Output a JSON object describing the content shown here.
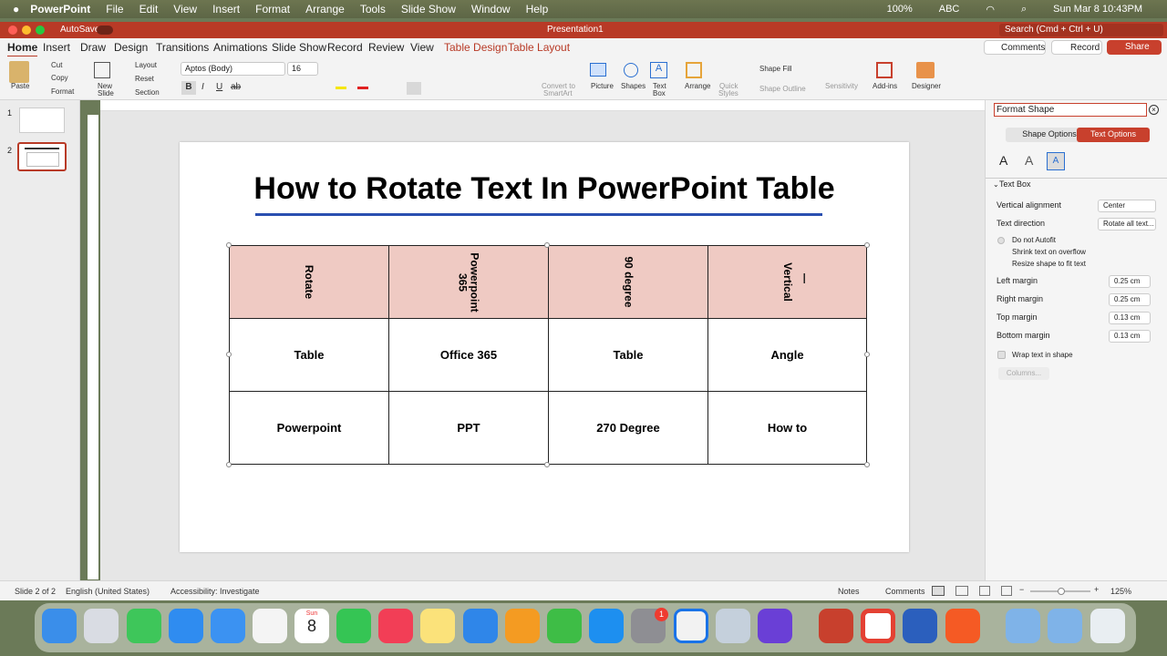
{
  "menubar": {
    "app_name": "PowerPoint",
    "items": [
      "File",
      "Edit",
      "View",
      "Insert",
      "Format",
      "Arrange",
      "Tools",
      "Slide Show",
      "Window",
      "Help"
    ],
    "battery": "100%",
    "keyboard": "ABC",
    "datetime": "Sun Mar 8  10:43PM"
  },
  "titlebar": {
    "autosave": "AutoSave",
    "document_title": "Presentation1",
    "search_placeholder": "Search (Cmd + Ctrl + U)"
  },
  "tabs": [
    "Home",
    "Insert",
    "Draw",
    "Design",
    "Transitions",
    "Animations",
    "Slide Show",
    "Record",
    "Review",
    "View",
    "Table Design",
    "Table Layout"
  ],
  "actions": {
    "comments": "Comments",
    "record": "Record",
    "share": "Share"
  },
  "ribbon": {
    "paste": "Paste",
    "cut": "Cut",
    "copy": "Copy",
    "format": "Format",
    "new_slide_1": "New",
    "new_slide_2": "Slide",
    "layout": "Layout",
    "reset": "Reset",
    "section": "Section",
    "font": "Aptos (Body)",
    "size": "16",
    "bold": "B",
    "italic": "I",
    "underline": "U",
    "strike": "ab",
    "convert_1": "Convert to",
    "convert_2": "SmartArt",
    "picture": "Picture",
    "shapes": "Shapes",
    "textbox_1": "Text",
    "textbox_2": "Box",
    "arrange": "Arrange",
    "quick_1": "Quick",
    "quick_2": "Styles",
    "shape_fill": "Shape Fill",
    "shape_outline": "Shape Outline",
    "sensitivity": "Sensitivity",
    "addins": "Add-ins",
    "designer": "Designer"
  },
  "thumbnails": [
    "1",
    "2"
  ],
  "slide": {
    "title": "How to Rotate Text In PowerPoint Table",
    "header": [
      "Rotate",
      "Powerpoint\n365",
      "90 degree",
      "Vertical"
    ],
    "row1": [
      "Table",
      "Office 365",
      "Table",
      "Angle"
    ],
    "row2": [
      "Powerpoint",
      "PPT",
      "270 Degree",
      "How to"
    ]
  },
  "panel": {
    "title": "Format Shape",
    "shape_options": "Shape Options",
    "text_options": "Text Options",
    "section": "Text Box",
    "vertical_alignment": "Vertical alignment",
    "vertical_alignment_value": "Center",
    "text_direction": "Text direction",
    "text_direction_value": "Rotate all text...",
    "do_not_autofit": "Do not Autofit",
    "shrink": "Shrink text on overflow",
    "resize": "Resize shape to fit text",
    "left_margin": "Left margin",
    "left_margin_value": "0.25 cm",
    "right_margin": "Right margin",
    "right_margin_value": "0.25 cm",
    "top_margin": "Top margin",
    "top_margin_value": "0.13 cm",
    "bottom_margin": "Bottom margin",
    "bottom_margin_value": "0.13 cm",
    "wrap": "Wrap text in shape",
    "columns": "Columns..."
  },
  "status": {
    "slide": "Slide 2 of 2",
    "language": "English (United States)",
    "accessibility": "Accessibility: Investigate",
    "notes": "Notes",
    "comments": "Comments",
    "zoom": "125%"
  },
  "dock": {
    "calendar_month": "Sun",
    "calendar_day": "8",
    "badge": "1"
  },
  "colors": {
    "brand": "#b83a26",
    "header_fill": "#efcac3",
    "accent": "#2a4fb0"
  }
}
